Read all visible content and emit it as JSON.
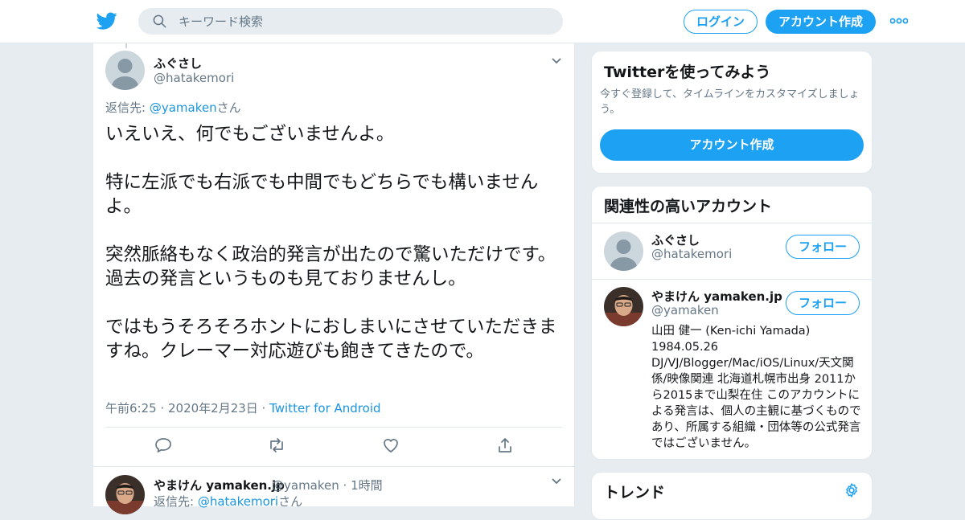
{
  "header": {
    "search_placeholder": "キーワード検索",
    "login_label": "ログイン",
    "signup_label": "アカウント作成"
  },
  "tweet": {
    "author_name": "ふぐさし",
    "author_handle": "@hatakemori",
    "reply_prefix": "返信先: ",
    "reply_handle": "@yamaken",
    "reply_suffix": "さん",
    "lines": [
      "いえいえ、何でもございませんよ。",
      "",
      "特に左派でも右派でも中間でもどちらでも構いませんよ。",
      "",
      "突然脈絡もなく政治的発言が出たので驚いただけです。",
      "過去の発言というものも見ておりませんし。",
      "",
      "ではもうそろそろホントにおしまいにさせていただきますね。クレーマー対応遊びも飽きてきたので。"
    ],
    "time": "午前6:25 · 2020年2月23日 · ",
    "source": "Twitter for Android"
  },
  "reply_tweet": {
    "author_name": "やまけん yamaken.jp",
    "author_handle": "@yamaken",
    "time_ago": " · 1時間",
    "reply_prefix": "返信先: ",
    "reply_handle": "@hatakemori",
    "reply_suffix": "さん"
  },
  "try_card": {
    "title": "Twitterを使ってみよう",
    "desc": "今すぐ登録して、タイムラインをカスタマイズしましょう。",
    "button": "アカウント作成"
  },
  "related": {
    "title": "関連性の高いアカウント",
    "follow_label": "フォロー",
    "accounts": [
      {
        "name": "ふぐさし",
        "handle": "@hatakemori"
      },
      {
        "name": "やまけん yamaken.jp",
        "handle": "@yamaken",
        "bio": "山田 健一 (Ken-ichi Yamada) 1984.05.26 DJ/VJ/Blogger/Mac/iOS/Linux/天文関係/映像関連 北海道札幌市出身 2011から2015まで山梨在住 このアカウントによる発言は、個人の主観に基づくものであり、所属する組織・団体等の公式発言ではございません。"
      }
    ]
  },
  "trends": {
    "title": "トレンド"
  },
  "colors": {
    "accent": "#1da1f2",
    "link": "#1b95e0",
    "muted": "#657786",
    "border": "#e1e8ed"
  }
}
